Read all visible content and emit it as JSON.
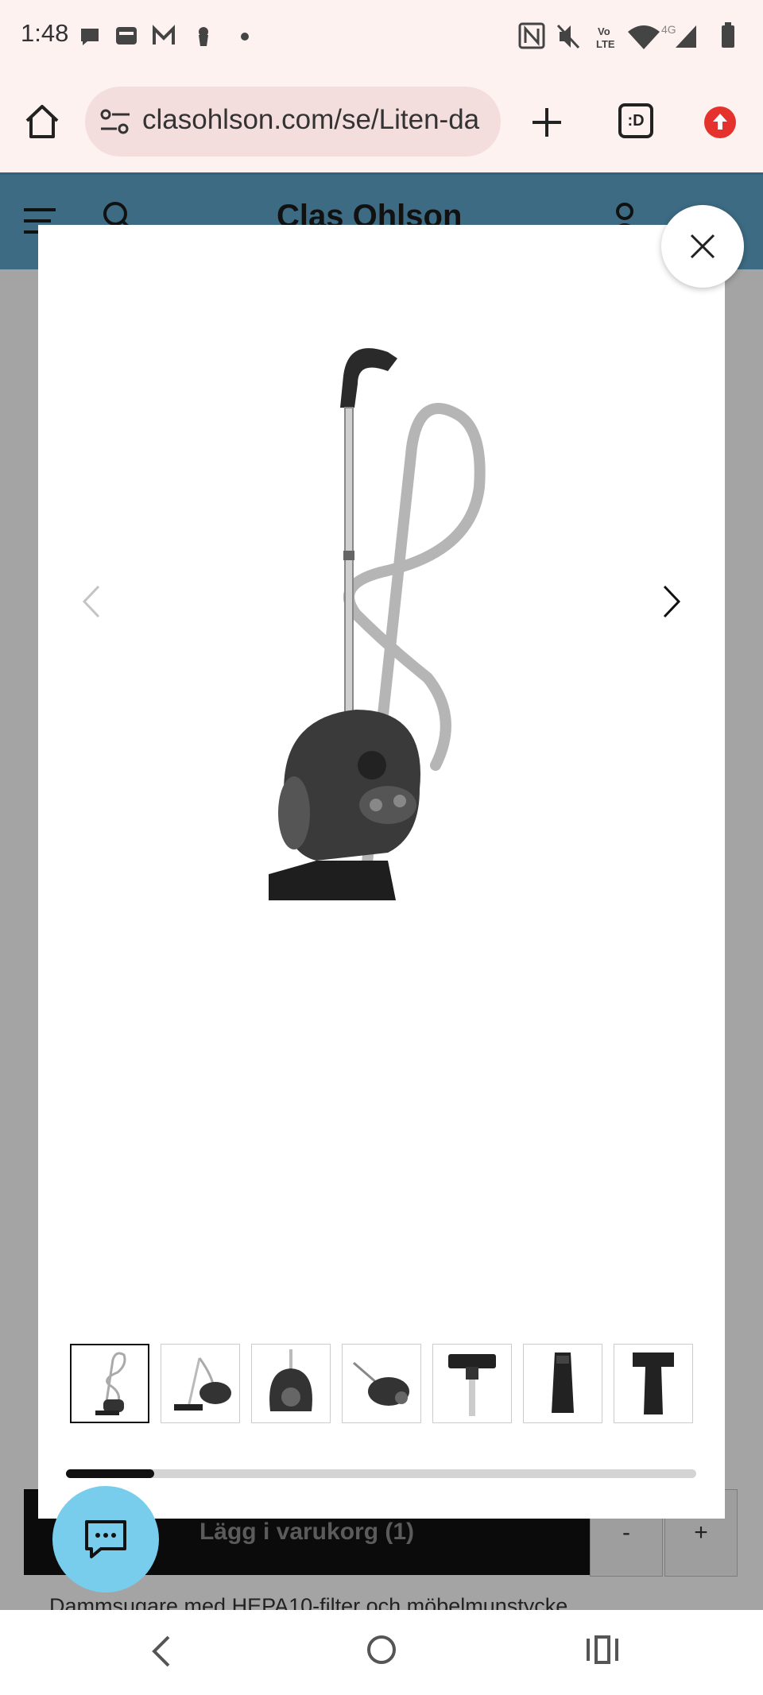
{
  "status_bar": {
    "time": "1:48",
    "network": "4G"
  },
  "browser": {
    "url": "clasohlson.com/se/Liten-da",
    "tab_icon_label": ":D"
  },
  "site": {
    "logo": "Clas Ohlson"
  },
  "product": {
    "add_to_cart_label": "Lägg i varukorg (1)",
    "qty_minus": "-",
    "qty_plus": "+",
    "bullet_text": "Dammsugare med HEPA10-filter och möbelmunstycke"
  },
  "gallery": {
    "thumbnail_count": 7,
    "active_index": 0,
    "scroll_progress": 0.14,
    "thumbnails": [
      {
        "name": "vacuum-upright"
      },
      {
        "name": "vacuum-side"
      },
      {
        "name": "vacuum-body-front"
      },
      {
        "name": "vacuum-lying"
      },
      {
        "name": "floor-nozzle"
      },
      {
        "name": "crevice-tool"
      },
      {
        "name": "brush-tool"
      }
    ]
  },
  "icons": {
    "home": "home-icon",
    "close": "close-icon",
    "prev": "chevron-left-icon",
    "next": "chevron-right-icon",
    "chat": "chat-icon"
  },
  "colors": {
    "header_blue": "#5aa0c3",
    "chat_blue": "#79cdec",
    "browser_bg": "#fdf2f0",
    "update_red": "#e5322d"
  }
}
